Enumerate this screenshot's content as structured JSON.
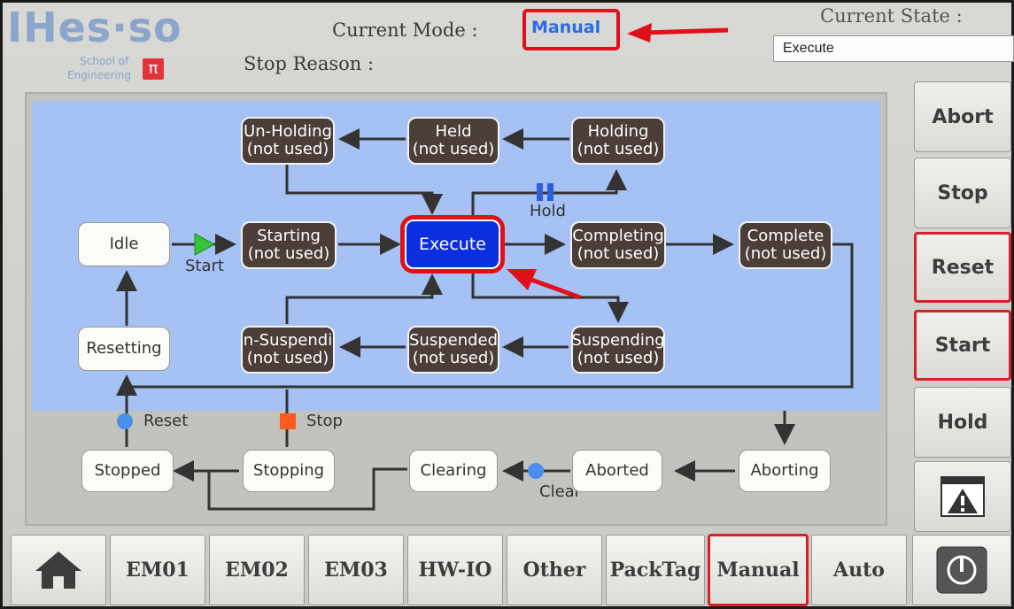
{
  "logo": {
    "main": "IHes·so",
    "line1": "School of",
    "line2": "Engineering",
    "pi": "π"
  },
  "header": {
    "mode_label": "Current Mode :",
    "mode_value": "Manual",
    "stop_reason_label": "Stop Reason :",
    "state_label": "Current State :",
    "state_value": "Execute"
  },
  "states": {
    "unholding": [
      "Un-Holding",
      "(not used)"
    ],
    "held": [
      "Held",
      "(not used)"
    ],
    "holding": [
      "Holding",
      "(not used)"
    ],
    "idle": "Idle",
    "starting": [
      "Starting",
      "(not used)"
    ],
    "execute": "Execute",
    "completing": [
      "Completing",
      "(not used)"
    ],
    "complete": [
      "Complete",
      "(not used)"
    ],
    "resetting": "Resetting",
    "unsuspending": [
      "n-Suspendi",
      "(not used)"
    ],
    "suspended": [
      "Suspended",
      "(not used)"
    ],
    "suspending": [
      "Suspending",
      "(not used)"
    ],
    "stopped": "Stopped",
    "stopping": "Stopping",
    "clearing": "Clearing",
    "aborted": "Aborted",
    "aborting": "Aborting"
  },
  "transitions": {
    "start": "Start",
    "hold": "Hold",
    "reset": "Reset",
    "stop": "Stop",
    "clear": "Clear"
  },
  "side_buttons": [
    "Abort",
    "Stop",
    "Reset",
    "Start",
    "Hold"
  ],
  "tabs": [
    "EM01",
    "EM02",
    "EM03",
    "HW-IO",
    "Other",
    "PackTag",
    "Manual",
    "Auto"
  ],
  "colors": {
    "execute": "#0a2ee0",
    "highlight": "#e0101a",
    "mode": "#2c6ae6",
    "diagram_bg": "#a6c1f4"
  }
}
